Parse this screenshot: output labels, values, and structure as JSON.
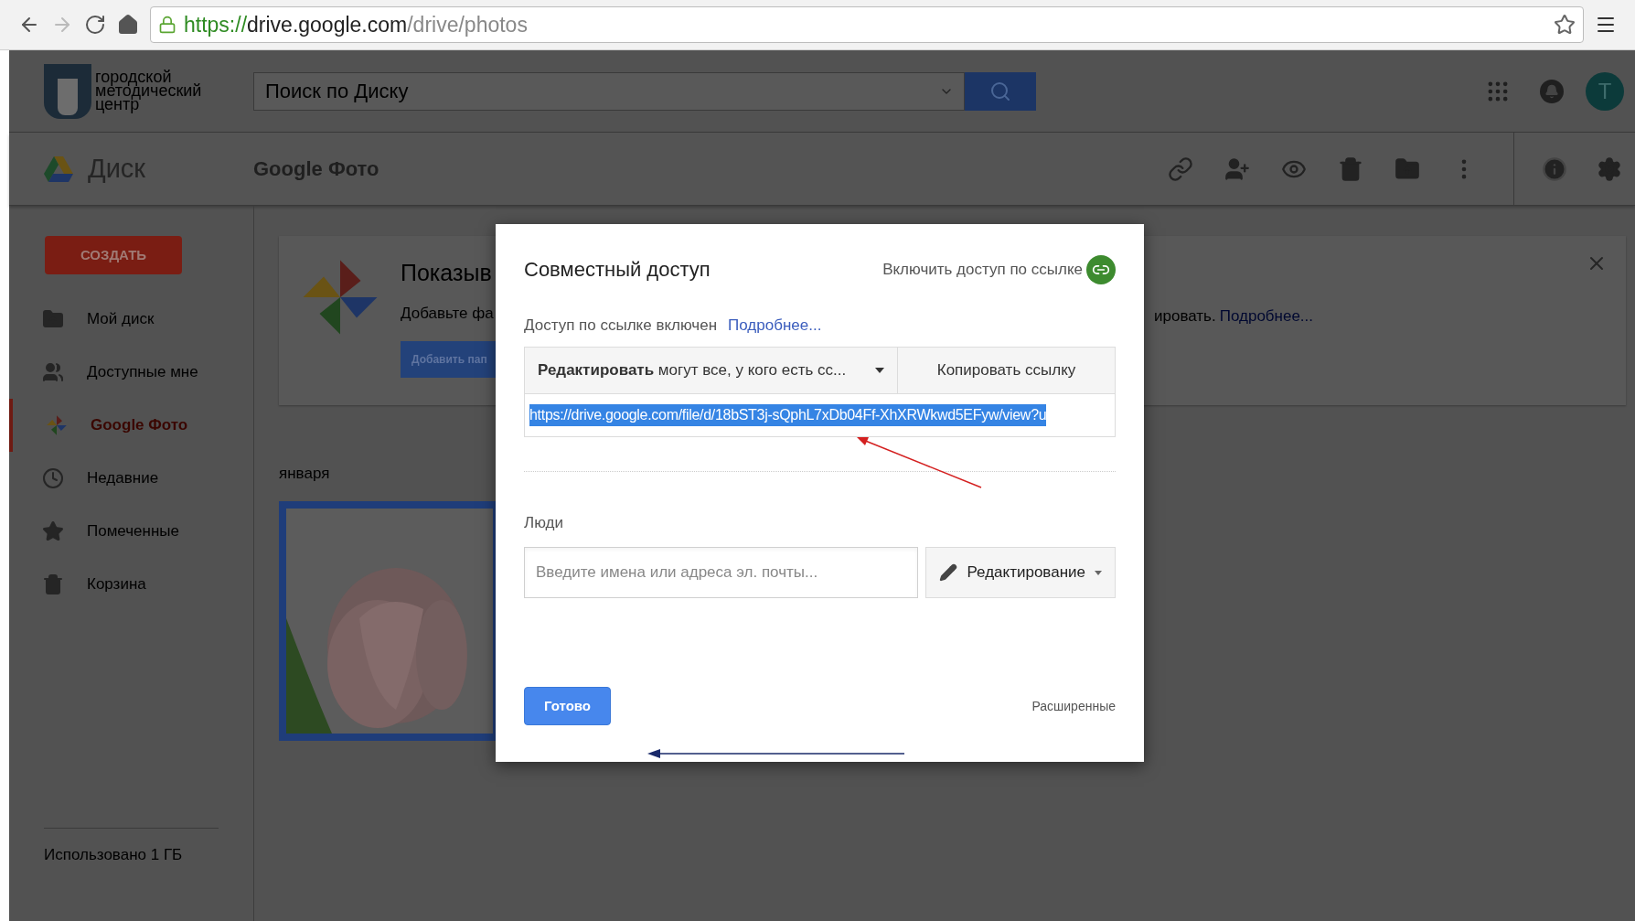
{
  "browser": {
    "url": {
      "scheme": "https://",
      "host": "drive.google.com",
      "path": "/drive/photos"
    }
  },
  "header": {
    "logo_lines": [
      "городской",
      "методический",
      "центр"
    ],
    "search": {
      "placeholder": "Поиск по Диску"
    },
    "avatar": "T"
  },
  "toolbar": {
    "app": "Диск",
    "folder": "Google Фото"
  },
  "sidebar": {
    "create": "СОЗДАТЬ",
    "items": [
      {
        "label": "Мой диск",
        "kind": "drive",
        "selected": false
      },
      {
        "label": "Доступные мне",
        "kind": "shared",
        "selected": false
      },
      {
        "label": "Google Фото",
        "kind": "photos",
        "selected": true
      },
      {
        "label": "Недавние",
        "kind": "recent",
        "selected": false
      },
      {
        "label": "Помеченные",
        "kind": "starred",
        "selected": false
      },
      {
        "label": "Корзина",
        "kind": "trash",
        "selected": false
      }
    ],
    "storage": "Использовано 1 ГБ"
  },
  "banner": {
    "title": "Показыв",
    "text": "Добавьте фа",
    "button": "Добавить пап",
    "text_right": "ировать.",
    "link": "Подробнее..."
  },
  "section": {
    "date": "января"
  },
  "dialog": {
    "title": "Совместный доступ",
    "link_toggle": "Включить доступ по ссылке",
    "status": "Доступ по ссылке включен",
    "more": "Подробнее...",
    "access": "**Редактировать** могут все, у кого есть сс...",
    "copy": "Копировать ссылку",
    "link": "https://drive.google.com/file/d/18bST3j-sQphL7xDb04Ff-XhXRWkwd5EFyw/view?u",
    "people_label": "Люди",
    "people": {
      "placeholder": "Введите имена или адреса эл. почты..."
    },
    "permission": "Редактирование",
    "done": "Готово",
    "advanced": "Расширенные"
  }
}
